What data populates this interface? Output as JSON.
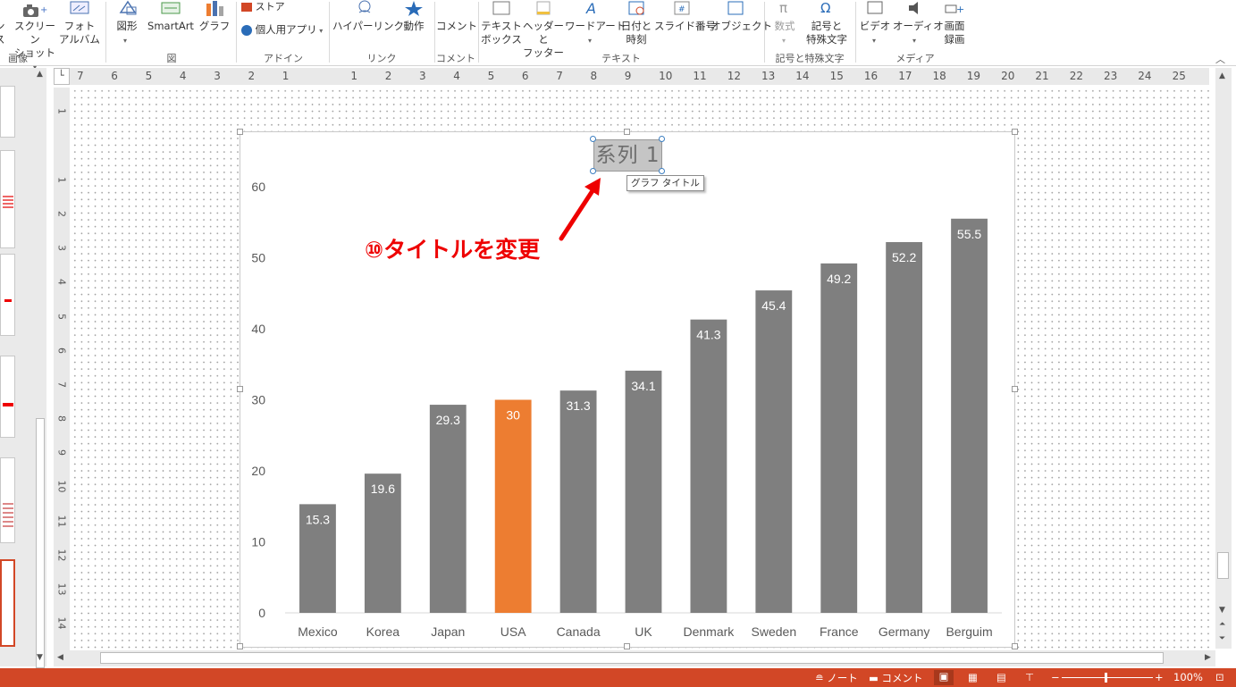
{
  "ribbon": {
    "images_group": {
      "label": "画像",
      "buttons": [
        {
          "label": "ン\nス",
          "partial": true
        },
        {
          "label": "スクリーン\nショット"
        },
        {
          "label": "フォト\nアルバム"
        }
      ]
    },
    "illustrations_group": {
      "label": "図",
      "buttons": [
        {
          "label": "図形"
        },
        {
          "label": "SmartArt"
        },
        {
          "label": "グラフ"
        }
      ]
    },
    "addins_group": {
      "label": "アドイン",
      "buttons": [
        {
          "label": "ストア"
        },
        {
          "label": "個人用アプリ"
        }
      ]
    },
    "links_group": {
      "label": "リンク",
      "buttons": [
        {
          "label": "ハイパーリンク"
        },
        {
          "label": "動作"
        }
      ]
    },
    "comments_group": {
      "label": "コメント",
      "buttons": [
        {
          "label": "コメント"
        }
      ]
    },
    "text_group": {
      "label": "テキスト",
      "buttons": [
        {
          "label": "テキスト\nボックス"
        },
        {
          "label": "ヘッダーと\nフッター"
        },
        {
          "label": "ワードアート"
        },
        {
          "label": "日付と\n時刻"
        },
        {
          "label": "スライド番号"
        },
        {
          "label": "オブジェクト"
        }
      ]
    },
    "symbols_group": {
      "label": "記号と特殊文字",
      "buttons": [
        {
          "label": "数式"
        },
        {
          "label": "記号と\n特殊文字"
        }
      ]
    },
    "media_group": {
      "label": "メディア",
      "buttons": [
        {
          "label": "ビデオ"
        },
        {
          "label": "オーディオ"
        },
        {
          "label": "画面\n録画"
        }
      ]
    }
  },
  "ruler": {
    "top": [
      "7",
      "6",
      "5",
      "4",
      "3",
      "2",
      "1",
      "",
      "1",
      "2",
      "3",
      "4",
      "5",
      "6",
      "7",
      "8",
      "9",
      "10",
      "11",
      "12",
      "13",
      "14",
      "15",
      "16",
      "17",
      "18",
      "19",
      "20",
      "21",
      "22",
      "23",
      "24",
      "25"
    ],
    "left": [
      "1",
      "",
      "1",
      "2",
      "3",
      "4",
      "5",
      "6",
      "7",
      "8",
      "9",
      "10",
      "11",
      "12",
      "13",
      "14"
    ]
  },
  "chart": {
    "title": "系列 1",
    "tooltip": "グラフ タイトル"
  },
  "chart_data": {
    "type": "bar",
    "title": "系列 1",
    "categories": [
      "Mexico",
      "Korea",
      "Japan",
      "USA",
      "Canada",
      "UK",
      "Denmark",
      "Sweden",
      "France",
      "Germany",
      "Berguim"
    ],
    "values": [
      15.3,
      19.6,
      29.3,
      30,
      31.3,
      34.1,
      41.3,
      45.4,
      49.2,
      52.2,
      55.5
    ],
    "value_labels": [
      "15.3",
      "19.6",
      "29.3",
      "30",
      "31.3",
      "34.1",
      "41.3",
      "45.4",
      "49.2",
      "52.2",
      "55.5"
    ],
    "highlight_category": "USA",
    "colors": {
      "default": "#7f7f7f",
      "highlight": "#ed7d31"
    },
    "ylim": [
      0,
      60
    ],
    "yticks": [
      0,
      10,
      20,
      30,
      40,
      50,
      60
    ],
    "xlabel": "",
    "ylabel": "",
    "grid": false,
    "legend": false
  },
  "annotation": {
    "text": "⑩タイトルを変更",
    "color": "#ee0000"
  },
  "status": {
    "notes": "ノート",
    "comments": "コメント",
    "zoom": "100%",
    "zoom_minus": "−",
    "zoom_plus": "+"
  },
  "colors": {
    "accent": "#d24726",
    "bar": "#7f7f7f",
    "bar_highlight": "#ed7d31",
    "annotation": "#ee0000"
  }
}
